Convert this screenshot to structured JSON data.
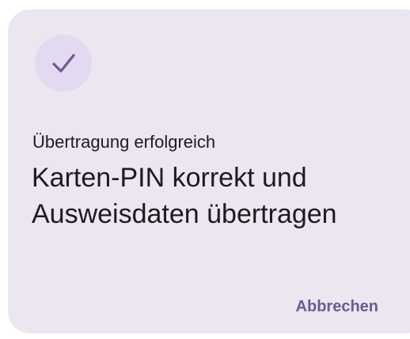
{
  "dialog": {
    "icon": "check-icon",
    "subtitle": "Übertragung erfolgreich",
    "title": "Karten-PIN korrekt und Ausweisdaten übertragen",
    "cancel_label": "Abbrechen"
  },
  "colors": {
    "dialog_background": "#ece6f0",
    "icon_badge_background": "#e4d9f2",
    "icon_stroke": "#6c5a94",
    "text_primary": "#1d1b20",
    "button_text": "#6c5a94"
  }
}
